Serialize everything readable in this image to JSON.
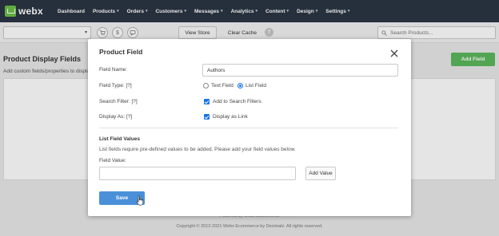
{
  "nav": {
    "brand": "webx",
    "items": [
      {
        "label": "Dashboard",
        "dropdown": false
      },
      {
        "label": "Products",
        "dropdown": true
      },
      {
        "label": "Orders",
        "dropdown": true
      },
      {
        "label": "Customers",
        "dropdown": true
      },
      {
        "label": "Messages",
        "dropdown": true
      },
      {
        "label": "Analytics",
        "dropdown": true
      },
      {
        "label": "Content",
        "dropdown": true
      },
      {
        "label": "Design",
        "dropdown": true
      },
      {
        "label": "Settings",
        "dropdown": true
      }
    ]
  },
  "toolbar": {
    "store_select_value": "",
    "view_store": "View Store",
    "clear_cache": "Clear Cache",
    "help_glyph": "?",
    "search_placeholder": "Search Products..."
  },
  "page": {
    "title": "Product Display Fields",
    "subtitle": "Add custom fields/properties to display",
    "add_field": "Add Field",
    "powered": "Powered by Webx Ecommerce",
    "copyright": "Copyright © 2012-2021 Webx Ecommerce by Decimalz. All rights reserved."
  },
  "modal": {
    "title": "Product Field",
    "field_name_label": "Field Name:",
    "field_name_value": "Authors",
    "field_type_label": "Field Type: [?]",
    "option_text_field": "Text Field",
    "option_list_field": "List Field",
    "selected_type": "List Field",
    "search_filter_label": "Search Filter: [?]",
    "search_filter_option": "Add to Search Filters",
    "search_filter_checked": true,
    "display_as_label": "Display As: [?]",
    "display_as_option": "Display as Link",
    "display_as_checked": true,
    "list_section_title": "List Field Values",
    "list_section_desc": "List fields require pre-defined values to be added. Please add your field values below.",
    "field_value_label": "Field Value:",
    "field_value_value": "",
    "add_value": "Add Value",
    "save": "Save"
  },
  "colors": {
    "nav_bg": "#2b3643",
    "brand_green": "#6cc04a",
    "add_field_green": "#5cb85c",
    "save_blue": "#4a90d9",
    "checkbox_blue": "#1a73e8"
  }
}
